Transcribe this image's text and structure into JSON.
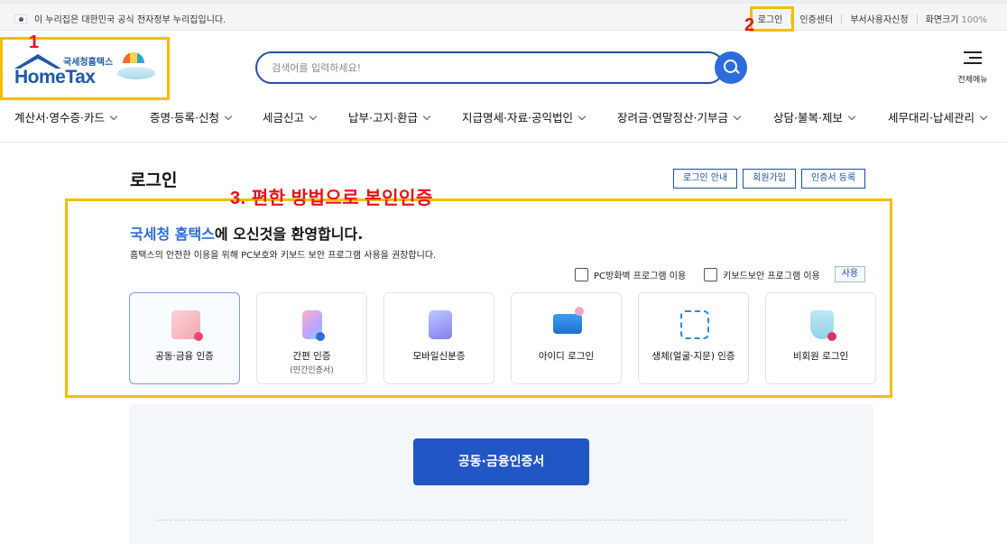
{
  "gov_banner": {
    "text": "이 누리집은 대한민국 공식 전자정부 누리집입니다.",
    "links": [
      "로그인",
      "인증센터",
      "부서사용자신청"
    ],
    "zoom_label": "화면크기",
    "zoom_value": "100%"
  },
  "logo": {
    "sub": "국세청홈택스",
    "main": "HomeTax"
  },
  "search": {
    "placeholder": "검색어를 입력하세요!"
  },
  "all_menu": {
    "label": "전체메뉴"
  },
  "gnb": [
    "계산서·영수증·카드",
    "증명·등록·신청",
    "세금신고",
    "납부·고지·환급",
    "지급명세·자료·공익법인",
    "장려금·연말정산·기부금",
    "상담·불복·제보",
    "세무대리·납세관리"
  ],
  "page": {
    "title": "로그인",
    "buttons": [
      "로그인 안내",
      "회원가입",
      "인증서 등록"
    ],
    "welcome_brand": "국세청 홈택스",
    "welcome_rest": "에 오신것을 환영합니다.",
    "notice": "홈택스의 안전한 이용을 위해 PC보호와 키보드 보안 프로그램 사용을 권장합니다.",
    "check_pc": "PC방화벽 프로그램 이용",
    "check_kb": "키보드보안 프로그램 이용",
    "use_button": "사용"
  },
  "login_methods": [
    {
      "title": "공동·금융 인증",
      "sub": "",
      "icon": "certificate-card-icon"
    },
    {
      "title": "간편 인증",
      "sub": "(민간인증서)",
      "icon": "simple-auth-phone-icon"
    },
    {
      "title": "모바일신분증",
      "sub": "",
      "icon": "mobile-id-icon"
    },
    {
      "title": "아이디 로그인",
      "sub": "",
      "icon": "laptop-login-icon"
    },
    {
      "title": "생체(얼굴·지문) 인증",
      "sub": "",
      "icon": "fingerprint-icon"
    },
    {
      "title": "비회원 로그인",
      "sub": "",
      "icon": "shield-guest-icon"
    }
  ],
  "main_button": "공동·금융인증서",
  "annotations": {
    "n1": "1",
    "n2": "2",
    "n3": "3. 편한 방법으로 본인인증",
    "color": "#f5bd02",
    "text_color": "#e8121a"
  }
}
